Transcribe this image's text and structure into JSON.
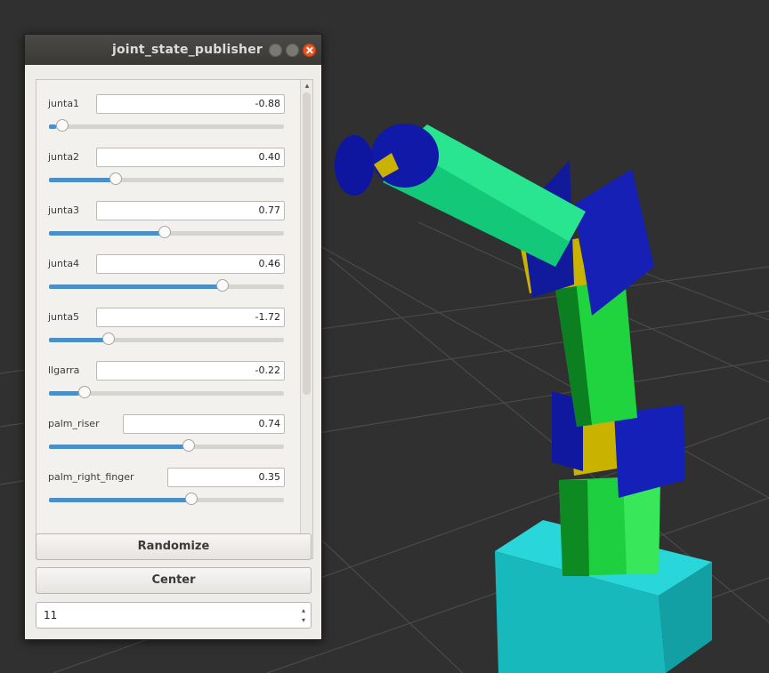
{
  "window": {
    "title": "joint_state_publisher"
  },
  "joints": [
    {
      "label": "junta1",
      "value": "-0.88",
      "position": 0.03
    },
    {
      "label": "junta2",
      "value": "0.40",
      "position": 0.27
    },
    {
      "label": "junta3",
      "value": "0.77",
      "position": 0.49
    },
    {
      "label": "junta4",
      "value": "0.46",
      "position": 0.75
    },
    {
      "label": "junta5",
      "value": "-1.72",
      "position": 0.24
    },
    {
      "label": "llgarra",
      "value": "-0.22",
      "position": 0.13
    },
    {
      "label": "palm_riser",
      "value": "0.74",
      "position": 0.6
    },
    {
      "label": "palm_right_finger",
      "value": "0.35",
      "position": 0.61
    }
  ],
  "buttons": {
    "randomize": "Randomize",
    "center": "Center"
  },
  "spinbox": {
    "value": "11"
  },
  "colors": {
    "background": "#303030",
    "slider_fill": "#4a8fc7",
    "close_button": "#e95420",
    "robot_green": "#22d64a",
    "robot_blue": "#1018a0",
    "robot_yellow": "#c8b400",
    "robot_base": "#1bc8cc"
  }
}
